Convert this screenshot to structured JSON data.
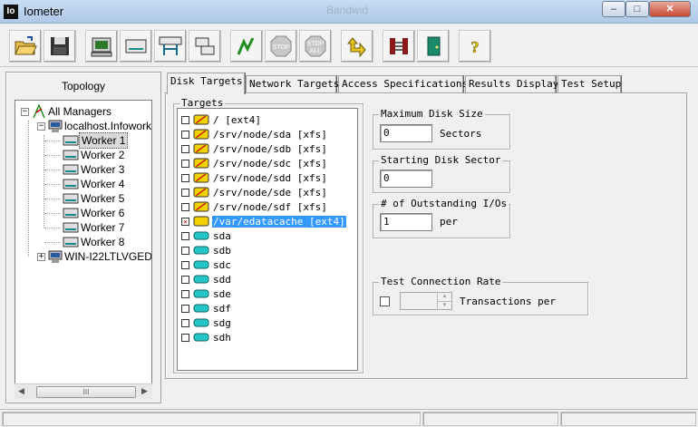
{
  "window": {
    "app_icon_text": "Io",
    "title": "Iometer",
    "background_text": "Bandwid",
    "controls": {
      "minimize": "–",
      "maximize": "□",
      "close": "✕"
    }
  },
  "toolbar": {
    "buttons": [
      {
        "icon": "open-folder-icon"
      },
      {
        "icon": "save-disk-icon"
      },
      {
        "icon": "display-window-icon"
      },
      {
        "icon": "new-disk-worker-icon"
      },
      {
        "icon": "new-network-worker-icon"
      },
      {
        "icon": "duplicate-worker-icon"
      },
      {
        "icon": "start-flag-icon"
      },
      {
        "icon": "stop-icon",
        "label": "STOP"
      },
      {
        "icon": "stop-all-icon",
        "label": "STOP",
        "sublabel": "ALL"
      },
      {
        "icon": "reset-workers-icon"
      },
      {
        "icon": "disconnect-icon"
      },
      {
        "icon": "exit-door-icon"
      },
      {
        "icon": "help-icon",
        "label": "?"
      }
    ]
  },
  "topology": {
    "title": "Topology",
    "tree": [
      {
        "label": "All Managers",
        "level": 0,
        "expander": "−",
        "icon": "all-managers-icon"
      },
      {
        "label": "localhost.Infowork",
        "level": 1,
        "expander": "−",
        "icon": "computer-icon"
      },
      {
        "label": "Worker 1",
        "level": 2,
        "icon": "worker-disk-icon",
        "selected": true
      },
      {
        "label": "Worker 2",
        "level": 2,
        "icon": "worker-disk-icon"
      },
      {
        "label": "Worker 3",
        "level": 2,
        "icon": "worker-disk-icon"
      },
      {
        "label": "Worker 4",
        "level": 2,
        "icon": "worker-disk-icon"
      },
      {
        "label": "Worker 5",
        "level": 2,
        "icon": "worker-disk-icon"
      },
      {
        "label": "Worker 6",
        "level": 2,
        "icon": "worker-disk-icon"
      },
      {
        "label": "Worker 7",
        "level": 2,
        "icon": "worker-disk-icon"
      },
      {
        "label": "Worker 8",
        "level": 2,
        "icon": "worker-disk-icon"
      },
      {
        "label": "WIN-I22LTLVGED",
        "level": 1,
        "expander": "+",
        "icon": "computer-icon"
      }
    ],
    "scroll_thumb_grip": "III"
  },
  "tabs": [
    {
      "label": "Disk Targets",
      "active": true
    },
    {
      "label": "Network Targets"
    },
    {
      "label": "Access Specifications"
    },
    {
      "label": "Results Display"
    },
    {
      "label": "Test Setup"
    }
  ],
  "disk_targets": {
    "targets_group_title": "Targets",
    "targets": [
      {
        "label": "/ [ext4]",
        "type": "mounted-fs",
        "checked": false
      },
      {
        "label": "/srv/node/sda [xfs]",
        "type": "mounted-fs",
        "checked": false
      },
      {
        "label": "/srv/node/sdb [xfs]",
        "type": "mounted-fs",
        "checked": false
      },
      {
        "label": "/srv/node/sdc [xfs]",
        "type": "mounted-fs",
        "checked": false
      },
      {
        "label": "/srv/node/sdd [xfs]",
        "type": "mounted-fs",
        "checked": false
      },
      {
        "label": "/srv/node/sde [xfs]",
        "type": "mounted-fs",
        "checked": false
      },
      {
        "label": "/srv/node/sdf [xfs]",
        "type": "mounted-fs",
        "checked": false
      },
      {
        "label": "/var/edatacache [ext4]",
        "type": "mounted-fs-yellow",
        "checked": true,
        "selected": true
      },
      {
        "label": "sda",
        "type": "raw-disk",
        "checked": false
      },
      {
        "label": "sdb",
        "type": "raw-disk",
        "checked": false
      },
      {
        "label": "sdc",
        "type": "raw-disk",
        "checked": false
      },
      {
        "label": "sdd",
        "type": "raw-disk",
        "checked": false
      },
      {
        "label": "sde",
        "type": "raw-disk",
        "checked": false
      },
      {
        "label": "sdf",
        "type": "raw-disk",
        "checked": false
      },
      {
        "label": "sdg",
        "type": "raw-disk",
        "checked": false
      },
      {
        "label": "sdh",
        "type": "raw-disk",
        "checked": false
      }
    ],
    "max_disk_size": {
      "title": "Maximum Disk Size",
      "value": "0",
      "unit": "Sectors"
    },
    "starting_sector": {
      "title": "Starting Disk Sector",
      "value": "0"
    },
    "outstanding_ios": {
      "title": "# of Outstanding I/Os",
      "value": "1",
      "unit": "per"
    },
    "test_connection_rate": {
      "title": "Test Connection Rate",
      "checked": false,
      "value": "",
      "unit": "Transactions per"
    }
  },
  "colors": {
    "selection": "#3399ff",
    "disk_yellow": "#f5d000",
    "disk_cyan": "#22c6c6",
    "title_bar": "#b9d1ee"
  }
}
